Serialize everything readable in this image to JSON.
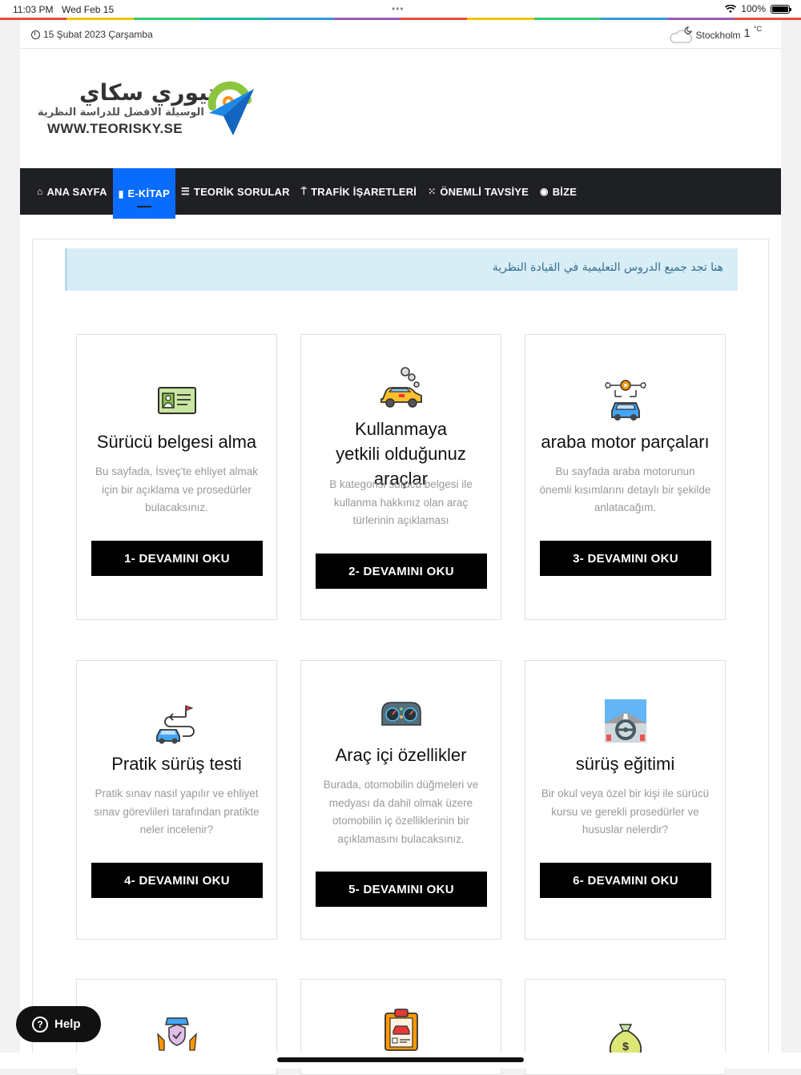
{
  "status_bar": {
    "time": "11:03 PM",
    "date": "Wed Feb 15",
    "dots": "•••",
    "battery": "100%"
  },
  "rainbow_colors": [
    "#e84c3d",
    "#f1c40f",
    "#2ecc71",
    "#1abc9c",
    "#3498db",
    "#9b59b6",
    "#e84c3d",
    "#f1c40f",
    "#2ecc71",
    "#3498db",
    "#9b59b6",
    "#e84c3d"
  ],
  "topbar": {
    "date": "15 Şubat 2023 Çarşamba",
    "city": "Stockholm",
    "temp": "1",
    "unit": "°C"
  },
  "logo": {
    "arabic_title": "تيوري سكاي",
    "arabic_subtitle": "الوسيلة الافضل للدراسة النظرية",
    "url": "WWW.TEORISKY.SE"
  },
  "nav": {
    "items": [
      {
        "label": "ANA SAYFA",
        "icon": "home-icon",
        "glyph": "⌂"
      },
      {
        "label": "E-KİTAP",
        "icon": "book-icon",
        "glyph": "▮"
      },
      {
        "label": "TEORİK SORULAR",
        "icon": "list-icon",
        "glyph": "☰"
      },
      {
        "label": "TRAFİK İŞARETLERİ",
        "icon": "sign-icon",
        "glyph": "⍑"
      },
      {
        "label": "ÖNEMLİ TAVSİYE",
        "icon": "grid-icon",
        "glyph": "⁙"
      },
      {
        "label": "BİZE",
        "icon": "messenger-icon",
        "glyph": "◉"
      }
    ]
  },
  "notice": "هنا تجد جميع الدروس التعليمية في القيادة النظرية",
  "cards": [
    {
      "title": "Sürücü belgesi alma",
      "desc": "Bu sayfada, İsveç'te ehliyet almak için bir açıklama ve prosedürler bulacaksınız.",
      "button": "1- DEVAMINI OKU",
      "icon": "id-card-icon"
    },
    {
      "title": "Kullanmaya yetkili olduğunuz araçlar",
      "desc": "B kategorisi sürücü belgesi ile kullanma hakkınız olan araç türlerinin açıklaması",
      "button": "2- DEVAMINI OKU",
      "icon": "car-smoke-icon"
    },
    {
      "title": "araba motor parçaları",
      "desc": "Bu sayfada araba motorunun önemli kısımlarını detaylı bir şekilde anlatacağım.",
      "button": "3- DEVAMINI OKU",
      "icon": "car-parts-icon"
    },
    {
      "title": "Pratik sürüş testi",
      "desc": "Pratik sınav nasıl yapılır ve ehliyet sınav görevlileri tarafından pratikte neler incelenir?",
      "button": "4- DEVAMINI OKU",
      "icon": "route-car-icon"
    },
    {
      "title": "Araç içi özellikler",
      "desc": "Burada, otomobilin düğmeleri ve medyası da dahil olmak üzere otomobilin iç özelliklerinin bir açıklamasını bulacaksınız.",
      "button": "5- DEVAMINI OKU",
      "icon": "dashboard-icon"
    },
    {
      "title": "sürüş eğitimi",
      "desc": "Bir okul veya özel bir kişi ile sürücü kursu ve gerekli prosedürler ve hususlar nelerdir?",
      "button": "6- DEVAMINI OKU",
      "icon": "steering-wheel-icon"
    }
  ],
  "partial_cards": [
    {
      "icon": "car-insurance-icon"
    },
    {
      "icon": "clipboard-car-icon"
    },
    {
      "icon": "money-bag-icon"
    }
  ],
  "help": {
    "label": "Help"
  }
}
